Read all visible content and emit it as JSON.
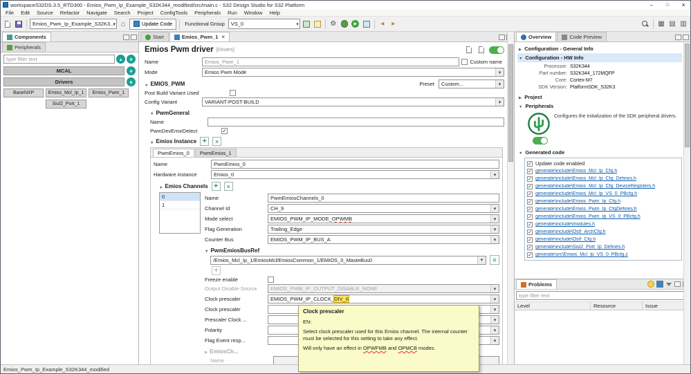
{
  "window": {
    "title": "workspaceS32DS.3.5_RTD300 - Emios_Pwm_Ip_Example_S32K344_modified/src/main.c - S32 Design Studio for S32 Platform"
  },
  "menubar": {
    "items": [
      "File",
      "Edit",
      "Source",
      "Refactor",
      "Navigate",
      "Search",
      "Project",
      "ConfigTools",
      "Peripherals",
      "Run",
      "Window",
      "Help"
    ]
  },
  "toolbar": {
    "project_combo": "Emios_Pwm_Ip_Example_S32K3...",
    "update_code": "Update Code",
    "functional_group_label": "Functional Group",
    "functional_group_value": "VS_0"
  },
  "left": {
    "tab_components": "Components",
    "tab_peripherals": "Peripherals",
    "filter_placeholder": "type filter text",
    "mcal": "MCAL",
    "drivers": "Drivers",
    "items": [
      "BaseNXP",
      "Emios_Mcl_Ip_1",
      "Emios_Pwm_1",
      "Siul2_Port_1"
    ]
  },
  "editor": {
    "tab_start": "Start",
    "tab_active": "Emios_Pwm_1",
    "title": "Emios Pwm driver",
    "title_tag": "[Drivers]",
    "name_label": "Name",
    "name_value": "Emios_Pwm_1",
    "custom_name": "Custom name",
    "mode_label": "Mode",
    "mode_value": "Emios Pwm Mode",
    "sect_emios_pwm": "EMIOS_PWM",
    "preset_label": "Preset",
    "preset_value": "Custom...",
    "post_build_label": "Post Build Variant Used",
    "config_variant_label": "Config Variant",
    "config_variant_value": "VARIANT-POST-BUILD",
    "sect_pwm_general": "PwmGeneral",
    "general_name_label": "Name",
    "dev_error_label": "PwmDevErrorDetect",
    "sect_instance": "Emios Instance",
    "inst_tabs": [
      "PwmEmios_0",
      "PwmEmios_1"
    ],
    "inst_name_label": "Name",
    "inst_name_value": "PwmEmios_0",
    "hw_label": "Hardware instance",
    "hw_value": "Emios_0",
    "sect_channels": "Emios Channels",
    "channel_rows": [
      "0",
      "1"
    ],
    "ch_name_label": "Name",
    "ch_name_value": "PwmEmiosChannels_0",
    "ch_id_label": "Channel Id",
    "ch_id_value": "CH_9",
    "mode_sel_label": "Mode select",
    "mode_sel_pre": "EMIOS_PWM_IP_MODE_",
    "mode_sel_err": "OPWMB",
    "flag_gen_label": "Flag Generation",
    "flag_gen_value": "Trailing_Edge",
    "counter_bus_label": "Counter Bus",
    "counter_bus_value": "EMIOS_PWM_IP_BUS_A",
    "sect_busref": "PwmEmiosBusRef",
    "busref_value": "/Emios_Mcl_Ip_1/EmiosMcl/EmiosCommon_1/EMIOS_0_MasteBus0",
    "freeze_label": "Freeze enable",
    "out_dis_label": "Output Disable Source",
    "out_dis_value": "EMIOS_PWM_IP_OUTPUT_DISABLE_NONE",
    "presc_label": "Clock prescaler",
    "presc_pre": "EMIOS_PWM_IP_CLOCK_",
    "presc_hl": "DIV_6",
    "presc2_label": "Clock prescaler",
    "presc_clock_label": "Prescaler Clock ...",
    "polarity_label": "Polarity",
    "flag_event_label": "Flag Event resp...",
    "sect_chh": "EmiosCh...",
    "chh_name_label": "Name"
  },
  "tooltip": {
    "title": "Clock prescaler",
    "lang": "EN:",
    "body1": "Select clock prescaler used for this Emios channel. The internal counter must be selected for this setting to take any effect.",
    "body2_parts": [
      "Will only have an effect in ",
      "OPWFMB",
      " and ",
      "OPMCB",
      " modes."
    ]
  },
  "overview": {
    "tab_overview": "Overview",
    "tab_code_preview": "Code Preview",
    "general_info": "Configuration - General Info",
    "hw_info": "Configuration - HW Info",
    "hw": [
      {
        "label": "Processor:",
        "value": "S32K344"
      },
      {
        "label": "Part number:",
        "value": "S32K344_172MQFP"
      },
      {
        "label": "Core:",
        "value": "Cortex-M7"
      },
      {
        "label": "SDK Version:",
        "value": "PlatformSDK_S32K3"
      }
    ],
    "project": "Project",
    "peripherals": "Peripherals",
    "peripherals_desc": "Configures the initialization of the SDK peripheral drivers.",
    "generated_code": "Generated code",
    "update_code_enabled": "Update code enabled",
    "files": [
      "generate\\include\\Emios_Mcl_Ip_Cfg.h",
      "generate\\include\\Emios_Mcl_Ip_Cfg_Defines.h",
      "generate\\include\\Emios_Mcl_Ip_Cfg_DeviceRegisters.h",
      "generate\\include\\Emios_Mcl_Ip_VS_0_PBcfg.h",
      "generate\\include\\Emios_Pwm_Ip_Cfg.h",
      "generate\\include\\Emios_Pwm_Ip_CfgDefines.h",
      "generate\\include\\Emios_Pwm_Ip_VS_0_PBcfg.h",
      "generate\\include\\modules.h",
      "generate\\include\\OsIf_ArchCfg.h",
      "generate\\include\\OsIf_Cfg.h",
      "generate\\include\\Siul2_Port_Ip_Defines.h",
      "generate\\src\\Emios_Mcl_Ip_VS_0_PBcfg.c"
    ]
  },
  "problems": {
    "tab": "Problems",
    "filter_placeholder": "type filter text",
    "columns": [
      "Level",
      "Resource",
      "Issue"
    ]
  },
  "statusbar": {
    "text": "Emios_Pwm_Ip_Example_S32K344_modified"
  }
}
